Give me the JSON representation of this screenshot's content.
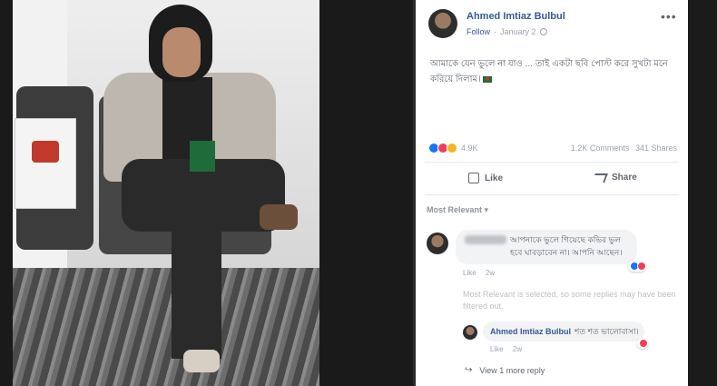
{
  "post": {
    "author": "Ahmed Imtiaz Bulbul",
    "follow_label": "Follow",
    "timestamp": "January 2",
    "text": "আমাকে যেন ভুলে না যাও ... তাই একটা ছবি পোস্ট করে সুখটা মনে করিয়ে দিলাম।",
    "reaction_count": "4.9K",
    "comments": "1.2K Comments",
    "shares": "341 Shares",
    "like_label": "Like",
    "share_label": "Share"
  },
  "comments_section": {
    "filter_label": "Most Relevant ▾",
    "comment1": {
      "text": "আপনাকে ভুলে গিয়েছে কভির ভুল হবে ঘাবড়াবেন না। আপনি আছেন।",
      "like": "Like",
      "time": "2w"
    },
    "notice": "Most Relevant is selected, so some replies may have been filtered out.",
    "reply": {
      "author": "Ahmed Imtiaz Bulbul",
      "text": "শত শত ভালোবাসা।",
      "like": "Like",
      "time": "2w"
    },
    "more_replies": "View 1 more reply"
  },
  "colors": {
    "link": "#385898",
    "muted": "#606770",
    "like_blue": "#1877f2",
    "love_red": "#f33e58"
  }
}
